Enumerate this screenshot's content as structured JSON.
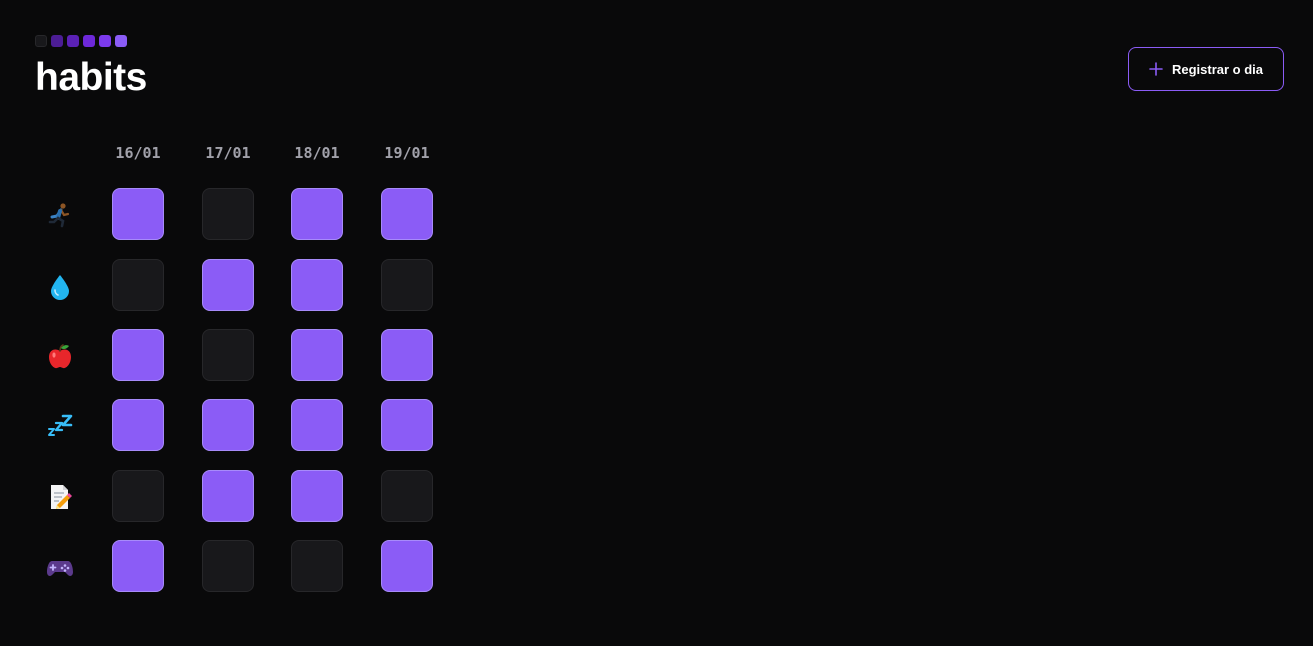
{
  "header": {
    "title": "habits",
    "register_label": "Registrar o dia",
    "register_icon": "plus-icon",
    "accent_color": "#8b5cf6"
  },
  "dates": [
    "16/01",
    "17/01",
    "18/01",
    "19/01"
  ],
  "habits": [
    {
      "icon": "running-person-icon",
      "completed": [
        true,
        false,
        true,
        true
      ]
    },
    {
      "icon": "water-drop-icon",
      "completed": [
        false,
        true,
        true,
        false
      ]
    },
    {
      "icon": "apple-icon",
      "completed": [
        true,
        false,
        true,
        true
      ]
    },
    {
      "icon": "sleep-zzz-icon",
      "completed": [
        true,
        true,
        true,
        true
      ]
    },
    {
      "icon": "memo-pencil-icon",
      "completed": [
        false,
        true,
        true,
        false
      ]
    },
    {
      "icon": "game-controller-icon",
      "completed": [
        true,
        false,
        false,
        true
      ]
    }
  ]
}
